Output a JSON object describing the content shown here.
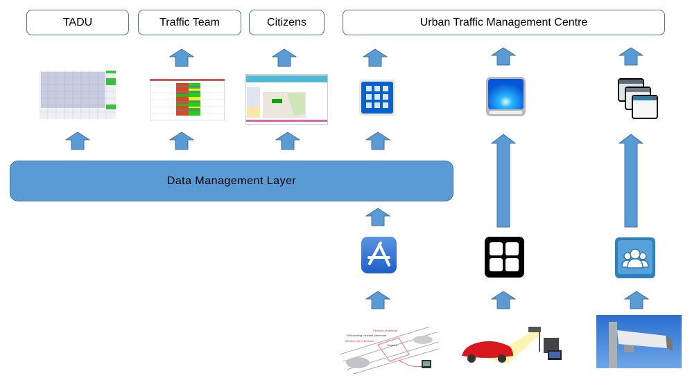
{
  "consumers": [
    {
      "label": "TADU"
    },
    {
      "label": "Traffic Team"
    },
    {
      "label": "Citizens"
    },
    {
      "label": "Urban Traffic Management Centre"
    }
  ],
  "layer": {
    "label": "Data Management Layer"
  },
  "icons": {
    "tadu_view": "spreadsheet-screenshot",
    "traffic_team_view": "traffic-status-table-screenshot",
    "citizens_view": "web-map-portal-screenshot",
    "utmc_1": "blue-grid-app-icon",
    "utmc_2": "blue-monitor-icon",
    "utmc_3": "stacked-windows-icon",
    "source_app_1": "app-store-icon",
    "source_app_2": "black-grid-icon",
    "source_app_3": "user-group-icon",
    "source_1": "road-sensor-diagram",
    "source_2": "car-speed-camera",
    "source_3": "cctv-camera-photo"
  },
  "sensor_image_labels": [
    "First row of sensors",
    "Self-sensing concrete pavement",
    "Second row of sensors",
    "Sensors"
  ],
  "colors": {
    "arrow": "#5b9bd5",
    "arrow_border": "#41719c",
    "layer": "#5b9bd5",
    "box_border": "#41719c"
  }
}
